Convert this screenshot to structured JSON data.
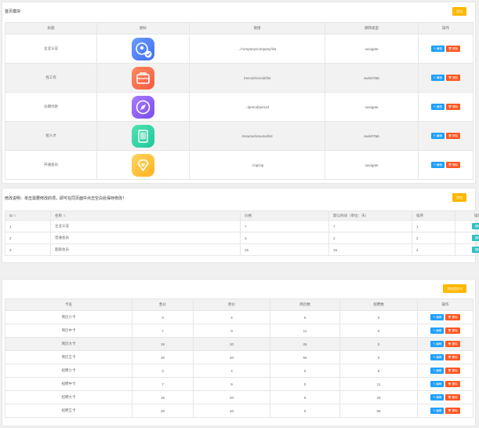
{
  "panel1": {
    "title": "首页模块",
    "add_label": "添加",
    "columns": [
      "标题",
      "图标",
      "链接",
      "跳转类型",
      "操作"
    ],
    "rows": [
      {
        "title": "企业认证",
        "link": "../company/company/list",
        "type": "navigate",
        "icon": "id-badge-icon",
        "grad": [
          "#6b9bff",
          "#3f6ef0"
        ]
      },
      {
        "title": "找工作",
        "link": "/recruit/recruit/list",
        "type": "switchTab",
        "icon": "briefcase-icon",
        "grad": [
          "#ff8a5c",
          "#f55a45"
        ]
      },
      {
        "title": "分期付款",
        "link": "../period/period",
        "type": "navigate",
        "icon": "compass-icon",
        "grad": [
          "#a77bff",
          "#7a4cf0"
        ]
      },
      {
        "title": "招人才",
        "link": "/resume/resume/list",
        "type": "switchTab",
        "icon": "tablet-icon",
        "grad": [
          "#4fe3b2",
          "#1fc89a"
        ]
      },
      {
        "title": "开通会员",
        "link": "../vip/vip",
        "type": "navigate",
        "icon": "diamond-icon",
        "grad": [
          "#ffd45c",
          "#ffb21f"
        ]
      }
    ],
    "edit_label": "✎ 编辑",
    "delete_label": "🗑 删除"
  },
  "panel2": {
    "title": "修改说明：单击需要修改的项，即可在同页面中点击空白处保存修改！",
    "add_label": "添加",
    "columns": [
      "ID",
      "名称",
      "价格",
      "默认时间（单位：天）",
      "排序",
      "操作"
    ],
    "rows": [
      {
        "id": "1",
        "name": "企业认证",
        "price": "7",
        "days": "7",
        "sort": "1"
      },
      {
        "id": "2",
        "name": "普通会员",
        "price": "3",
        "days": "2",
        "sort": "2"
      },
      {
        "id": "3",
        "name": "超级会员",
        "price": "15",
        "days": "15",
        "sort": "4"
      }
    ],
    "delete_label": "删除"
  },
  "panel3": {
    "add_label": "添加会员卡",
    "columns": [
      "卡名",
      "售价",
      "原价",
      "简历数",
      "招聘数",
      "操作"
    ],
    "rows": [
      {
        "name": "简历小卡",
        "price": "3",
        "orig": "4",
        "resumes": "5",
        "jobs": "0"
      },
      {
        "name": "简历中卡",
        "price": "7",
        "orig": "9",
        "resumes": "11",
        "jobs": "0"
      },
      {
        "name": "简历大卡",
        "price": "15",
        "orig": "20",
        "resumes": "26",
        "jobs": "0"
      },
      {
        "name": "简历王卡",
        "price": "30",
        "orig": "40",
        "resumes": "55",
        "jobs": "0"
      },
      {
        "name": "招聘小卡",
        "price": "3",
        "orig": "4",
        "resumes": "0",
        "jobs": "5"
      },
      {
        "name": "招聘中卡",
        "price": "7",
        "orig": "9",
        "resumes": "0",
        "jobs": "11"
      },
      {
        "name": "招聘大卡",
        "price": "15",
        "orig": "20",
        "resumes": "0",
        "jobs": "26"
      },
      {
        "name": "招聘王卡",
        "price": "30",
        "orig": "40",
        "resumes": "0",
        "jobs": "55"
      }
    ],
    "edit_label": "✎ 编辑",
    "delete_label": "🗑 删除"
  }
}
